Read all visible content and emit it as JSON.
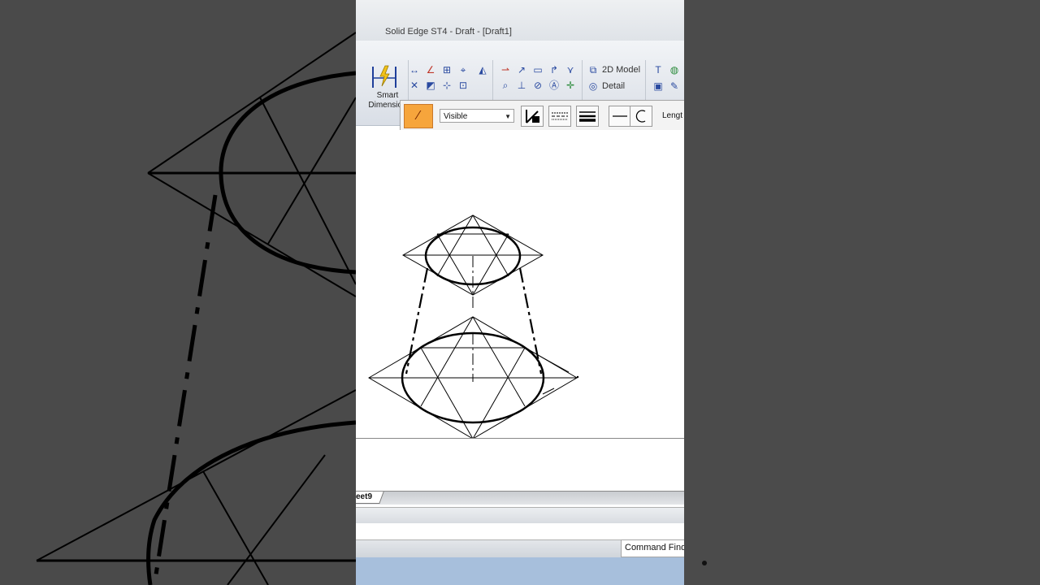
{
  "window": {
    "title": "Solid Edge ST4 - Draft - [Draft1]"
  },
  "ribbon": {
    "smart_dimension_label": "Smart\nDimension",
    "model_2d_label": "2D Model",
    "detail_label": "Detail"
  },
  "line_toolbar": {
    "line_type": "Visible",
    "length_label": "Lengt"
  },
  "tabs": {
    "sheet_label": "eet9"
  },
  "status": {
    "command_finder": "Command Find"
  },
  "colors": {
    "accent_orange": "#f6a53c",
    "taskbar_blue": "#a7bfdc",
    "background_gray": "#4a4a4a"
  },
  "icons": [
    "smart-dimension-icon",
    "2d-model-icon",
    "detail-icon",
    "text-icon",
    "globe-icon",
    "line-style-icon",
    "line-color-icon",
    "dash-pattern-icon",
    "line-width-icon",
    "line-end-icon",
    "arc-end-icon"
  ]
}
